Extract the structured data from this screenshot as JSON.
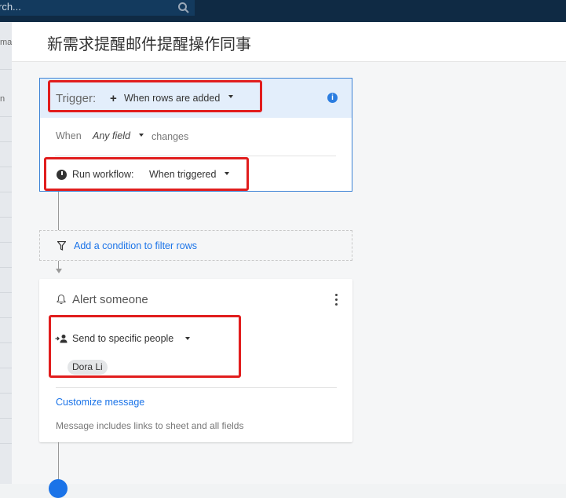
{
  "top_bar": {
    "search_text": "rch..."
  },
  "left_strip": {
    "fragments": [
      "ma",
      "n"
    ]
  },
  "dialog": {
    "title": "新需求提醒邮件提醒操作同事"
  },
  "trigger": {
    "label": "Trigger:",
    "plus_icon": "+",
    "value": "When rows are added",
    "info_icon": "i",
    "when_label": "When",
    "when_field": "Any field",
    "when_changes": "changes",
    "run_label": "Run workflow:",
    "run_value": "When triggered"
  },
  "filter": {
    "link": "Add a condition to filter rows"
  },
  "alert": {
    "title": "Alert someone",
    "send_label": "Send to specific people",
    "recipient": "Dora Li",
    "customize_link": "Customize message",
    "note": "Message includes links to sheet and all fields"
  },
  "colors": {
    "accent": "#1a73e8",
    "highlight": "#e11d1d",
    "trigger_bg": "#e3eefb",
    "topbar": "#0f2a44"
  }
}
